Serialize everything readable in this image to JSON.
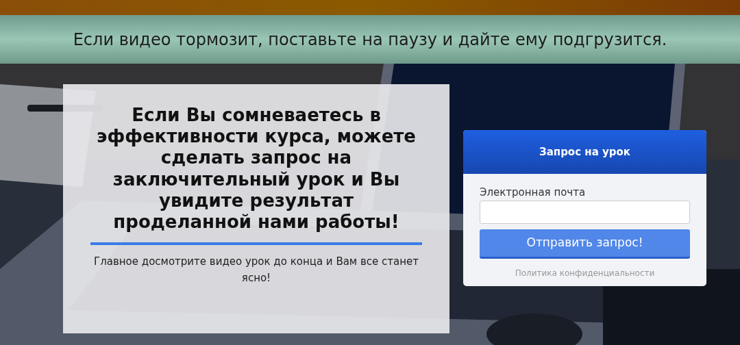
{
  "banner": {
    "text": "Если видео тормозит, поставьте на паузу и дайте ему подгрузится."
  },
  "hero": {
    "info": {
      "heading": "Если Вы сомневаетесь в эффективности курса, можете сделать запрос на заключительный урок и Вы увидите результат проделанной нами работы!",
      "note": "Главное досмотрите видео урок до конца и Вам все станет ясно!"
    },
    "form": {
      "title": "Запрос на урок",
      "field_label": "Электронная почта",
      "submit": "Отправить запрос!",
      "privacy_link": "Политика конфиденциальности"
    }
  }
}
